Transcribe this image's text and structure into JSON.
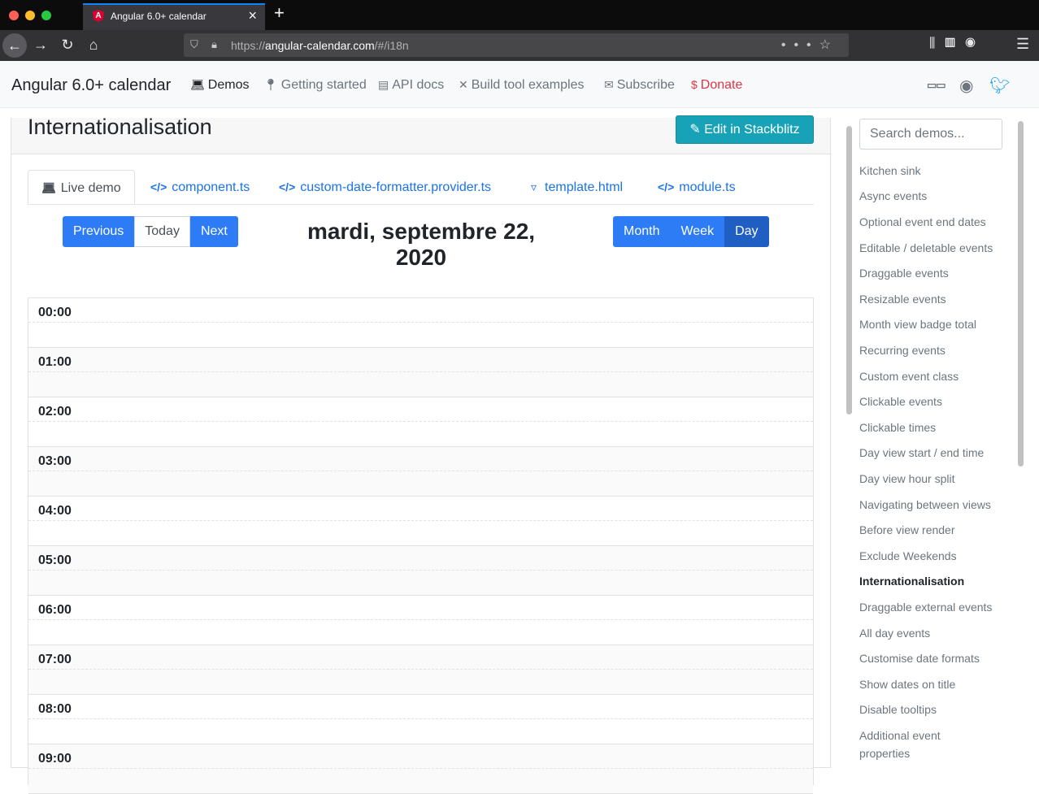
{
  "browser": {
    "tab_title": "Angular 6.0+ calendar",
    "ghost_tab_title": "Angular 6.0+ calendar",
    "url_scheme": "https://",
    "url_host": "angular-calendar.com",
    "url_path": "/#/i18n"
  },
  "site": {
    "brand": "Angular 6.0+ calendar",
    "nav": [
      {
        "label": "Demos",
        "icon": "laptop-icon"
      },
      {
        "label": "Getting started",
        "icon": "pin-icon"
      },
      {
        "label": "API docs",
        "icon": "book-icon"
      },
      {
        "label": "Build tool examples",
        "icon": "tools-icon"
      },
      {
        "label": "Subscribe",
        "icon": "envelope-icon"
      },
      {
        "label": "Donate",
        "icon": "dollar-icon"
      }
    ],
    "social": [
      "npm-icon",
      "github-icon",
      "twitter-icon"
    ]
  },
  "page": {
    "title": "Internationalisation",
    "stackblitz_label": "Edit in Stackblitz",
    "tabs": [
      "Live demo",
      "component.ts",
      "custom-date-formatter.provider.ts",
      "template.html",
      "module.ts"
    ]
  },
  "calendar": {
    "nav_buttons": [
      "Previous",
      "Today",
      "Next"
    ],
    "view_buttons": [
      "Month",
      "Week",
      "Day"
    ],
    "active_view": "Day",
    "date_line1": "mardi, septembre 22,",
    "date_line2": "2020",
    "hours": [
      "00:00",
      "01:00",
      "02:00",
      "03:00",
      "04:00",
      "05:00",
      "06:00",
      "07:00",
      "08:00",
      "09:00"
    ]
  },
  "sidebar": {
    "search_placeholder": "Search demos...",
    "active": "Internationalisation",
    "links": [
      "Kitchen sink",
      "Async events",
      "Optional event end dates",
      "Editable / deletable events",
      "Draggable events",
      "Resizable events",
      "Month view badge total",
      "Recurring events",
      "Custom event class",
      "Clickable events",
      "Clickable times",
      "Day view start / end time",
      "Day view hour split",
      "Navigating between views",
      "Before view render",
      "Exclude Weekends",
      "Internationalisation",
      "Draggable external events",
      "All day events",
      "Customise date formats",
      "Show dates on title",
      "Disable tooltips",
      "Additional event",
      "properties"
    ]
  }
}
